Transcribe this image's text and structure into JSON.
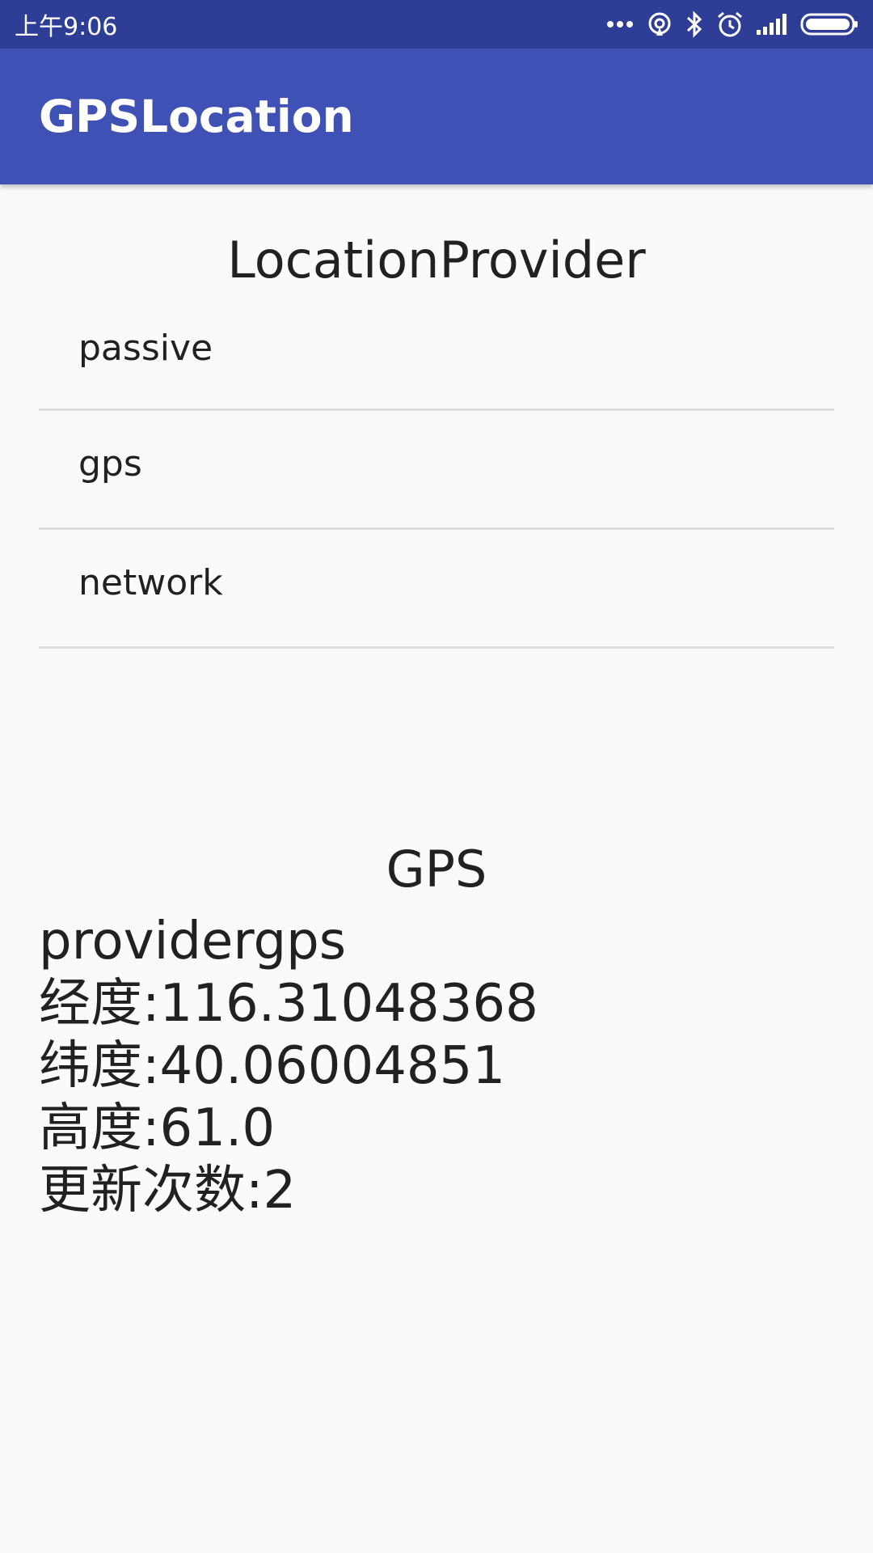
{
  "status_bar": {
    "time": "上午9:06",
    "icons": [
      "more-dots-icon",
      "hotspot-icon",
      "bluetooth-icon",
      "alarm-icon",
      "signal-icon",
      "battery-icon"
    ]
  },
  "app_bar": {
    "title": "GPSLocation",
    "color": "#3f51b5",
    "status_color": "#2e3e97"
  },
  "providers": {
    "title": "LocationProvider",
    "items": [
      "passive",
      "gps",
      "network"
    ]
  },
  "gps": {
    "title": "GPS",
    "lines": [
      "providergps",
      "经度:116.31048368",
      "纬度:40.06004851",
      "高度:61.0",
      "更新次数:2"
    ]
  }
}
